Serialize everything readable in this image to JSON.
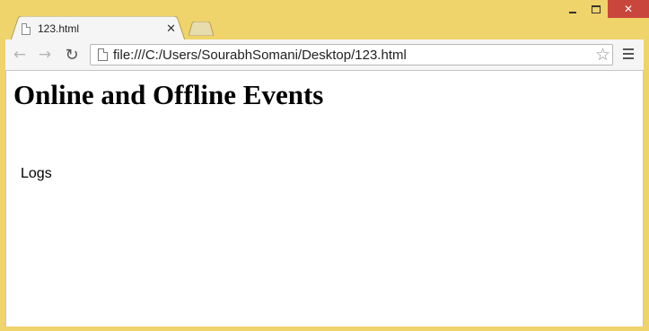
{
  "window": {
    "minimize_icon": "minimize-icon",
    "maximize_icon": "maximize-icon",
    "close_icon": "close-icon",
    "close_color": "#c9463d",
    "frame_color": "#efd36b"
  },
  "tabs": [
    {
      "label": "123.html",
      "active": true,
      "icon": "page-icon",
      "close_glyph": "✕"
    }
  ],
  "toolbar": {
    "back_icon": "back-arrow-icon",
    "forward_icon": "forward-arrow-icon",
    "reload_icon": "reload-icon",
    "url": "file:///C:/Users/SourabhSomani/Desktop/123.html",
    "bookmark_icon": "star-icon",
    "menu_icon": "menu-icon"
  },
  "page": {
    "heading": "Online and Offline Events",
    "logs_label": "Logs"
  }
}
